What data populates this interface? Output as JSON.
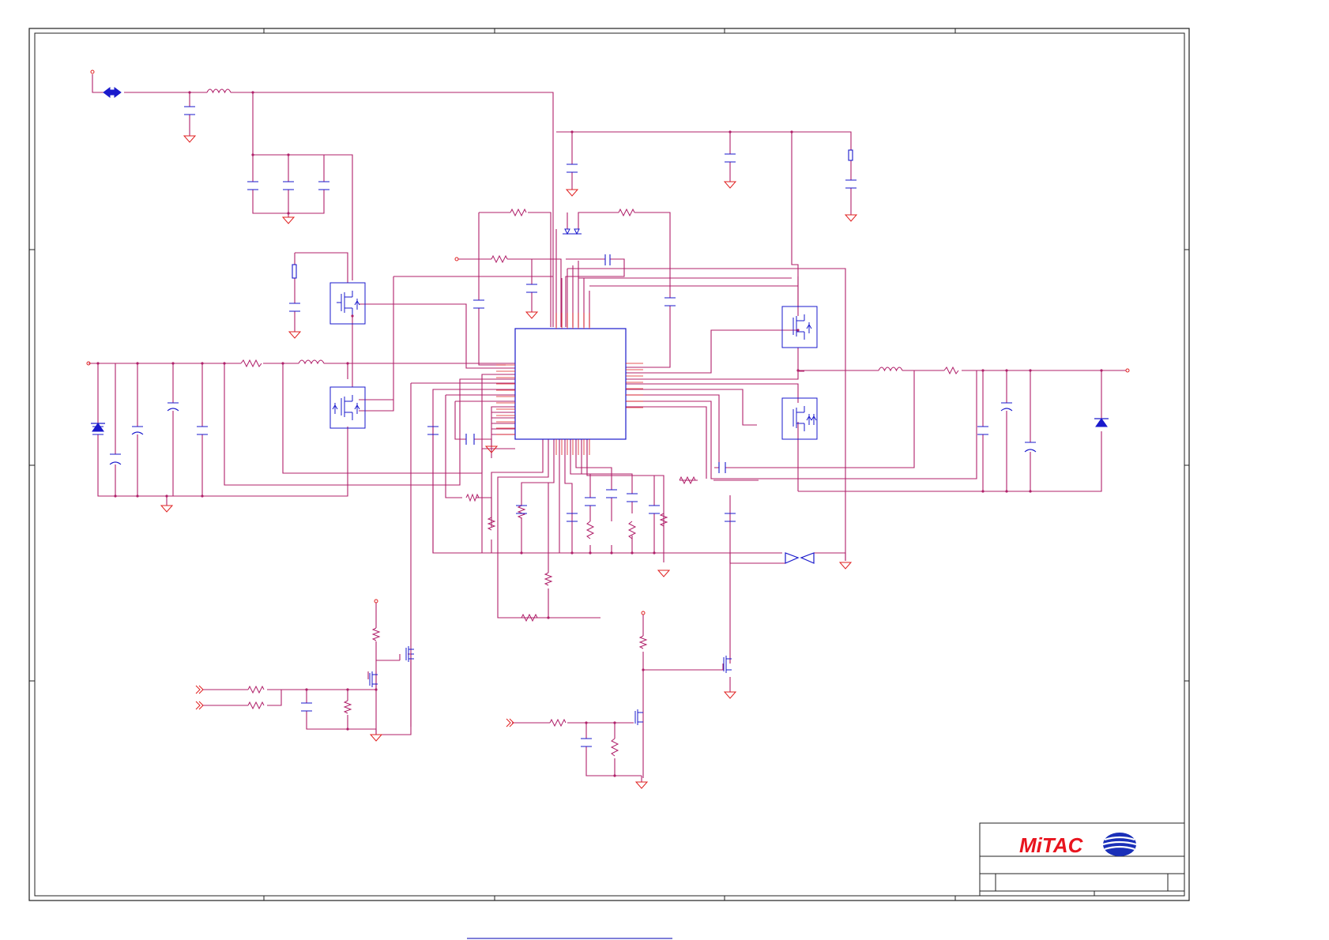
{
  "title_block": {
    "logo_text": "MiTAC",
    "logo_emblem": "mitac-globe-emblem"
  },
  "colors": {
    "wire": "#b0206a",
    "component": "#1a1acc",
    "ground": "#e02020",
    "frame": "#202020",
    "logo": "#e8141e",
    "link": "#3030c0"
  },
  "icons": [
    "ground-symbol",
    "capacitor-symbol",
    "resistor-symbol",
    "inductor-symbol",
    "mosfet-symbol",
    "zener-diode-symbol",
    "bidirectional-arrow-icon",
    "offpage-connector-icon"
  ],
  "footer_link": ""
}
